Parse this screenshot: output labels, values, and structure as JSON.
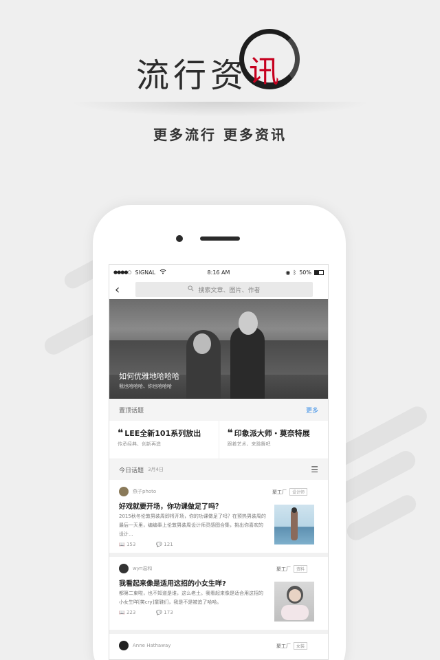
{
  "promo": {
    "title_chars": [
      "流",
      "行",
      "资"
    ],
    "title_highlight": "讯",
    "subtitle": "更多流行  更多资讯",
    "accent_color": "#c6001e"
  },
  "status_bar": {
    "signal_dots": "●●●●○",
    "carrier": "SIGNAL",
    "wifi_icon": "wifi-icon",
    "time": "8:16 AM",
    "battery_percent": "50%"
  },
  "nav": {
    "back_icon": "chevron-left-icon",
    "search_placeholder": "搜索文章、图片、作者"
  },
  "hero": {
    "headline": "如何优雅地哈哈哈",
    "subline": "我也哈哈哈、你也哈哈哈"
  },
  "pinned": {
    "label": "置顶话题",
    "more": "更多",
    "topics": [
      {
        "title": "LEE全新101系列放出",
        "desc": "传承经典、创新再造"
      },
      {
        "title": "印象派大师・莫奈特展",
        "desc": "跟着艺术、来跳舞吧"
      }
    ]
  },
  "today": {
    "label": "今日话题",
    "date": "3月4日"
  },
  "articles": [
    {
      "author": "燕子photo",
      "source": "聚工厂",
      "tag": "设计师",
      "title": "好戏就要开场，你功课做足了吗？",
      "excerpt": "2015秋冬伦敦男装周即将开场，你的功课做足了吗？在预热男装周的最后一天里，编编奉上伦敦男装周设计师灵感图合集，挑出你喜欢的设计...",
      "reads": "153",
      "comments": "121"
    },
    {
      "author": "wyn温和",
      "source": "聚工厂",
      "tag": "资料",
      "title": "我看起来像是适用这招的小女生咩?",
      "excerpt": "都第二束啦，也不知道是谁，这么老土。我看起来像是适合用这招的小女生咩[笑cry]童鞋们，我是不是被追了哈哈。",
      "reads": "223",
      "comments": "173"
    },
    {
      "author": "Anne Hathaway",
      "source": "聚工厂",
      "tag": "女装"
    }
  ]
}
